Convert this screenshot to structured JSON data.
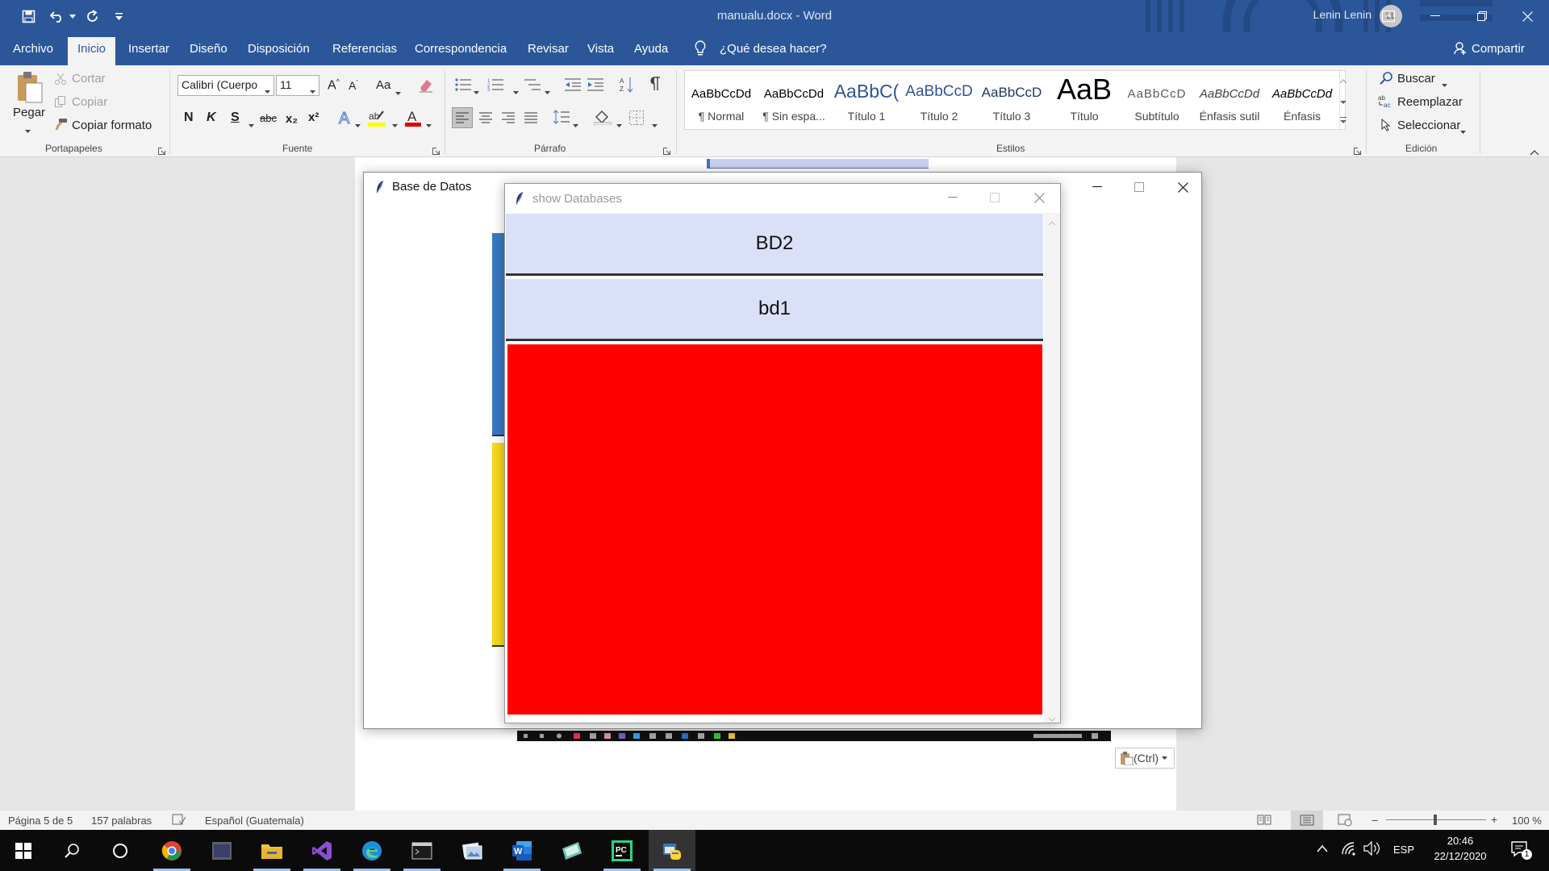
{
  "word": {
    "doc_title": "manualu.docx  -  Word",
    "user_name": "Lenin Lenin",
    "user_initials": "LL",
    "tabs": [
      "Archivo",
      "Inicio",
      "Insertar",
      "Diseño",
      "Disposición",
      "Referencias",
      "Correspondencia",
      "Revisar",
      "Vista",
      "Ayuda"
    ],
    "active_tab": "Inicio",
    "tell_me": "¿Qué desea hacer?",
    "share": "Compartir"
  },
  "ribbon": {
    "clipboard": {
      "paste": "Pegar",
      "cut": "Cortar",
      "copy": "Copiar",
      "format_painter": "Copiar formato",
      "label": "Portapapeles"
    },
    "font": {
      "name": "Calibri (Cuerpo",
      "size": "11",
      "label": "Fuente",
      "bold": "N",
      "italic": "K",
      "underline": "S",
      "strike": "abc",
      "sub": "x₂",
      "sup": "x²",
      "case": "Aa"
    },
    "paragraph": {
      "label": "Párrafo"
    },
    "styles": {
      "label": "Estilos",
      "items": [
        {
          "preview": "AaBbCcDd",
          "name": "¶ Normal"
        },
        {
          "preview": "AaBbCcDd",
          "name": "¶ Sin espa..."
        },
        {
          "preview": "AaBbC(",
          "name": "Título 1"
        },
        {
          "preview": "AaBbCcD",
          "name": "Título 2"
        },
        {
          "preview": "AaBbCcD",
          "name": "Título 3"
        },
        {
          "preview": "AaB",
          "name": "Título"
        },
        {
          "preview": "AaBbCcD",
          "name": "Subtítulo"
        },
        {
          "preview": "AaBbCcDd",
          "name": "Énfasis sutil"
        },
        {
          "preview": "AaBbCcDd",
          "name": "Énfasis"
        }
      ]
    },
    "editing": {
      "find": "Buscar",
      "replace": "Reemplazar",
      "select": "Seleccionar",
      "label": "Edición"
    }
  },
  "windows": {
    "main": {
      "title": "Base de Datos"
    },
    "dialog": {
      "title": "show Databases",
      "items": [
        "BD2",
        "bd1"
      ]
    }
  },
  "paste_options": "(Ctrl)",
  "status": {
    "page": "Página 5 de 5",
    "words": "157 palabras",
    "language": "Español (Guatemala)",
    "zoom": "100 %"
  },
  "taskbar": {
    "lang": "ESP",
    "time": "20:46",
    "date": "22/12/2020",
    "notifications": "1"
  },
  "colors": {
    "word_blue": "#2b579a",
    "list_item_bg": "#dae0f7",
    "canvas_red": "#ff0000",
    "bar_blue": "#3a78c3",
    "bar_yellow": "#f8d81c"
  }
}
